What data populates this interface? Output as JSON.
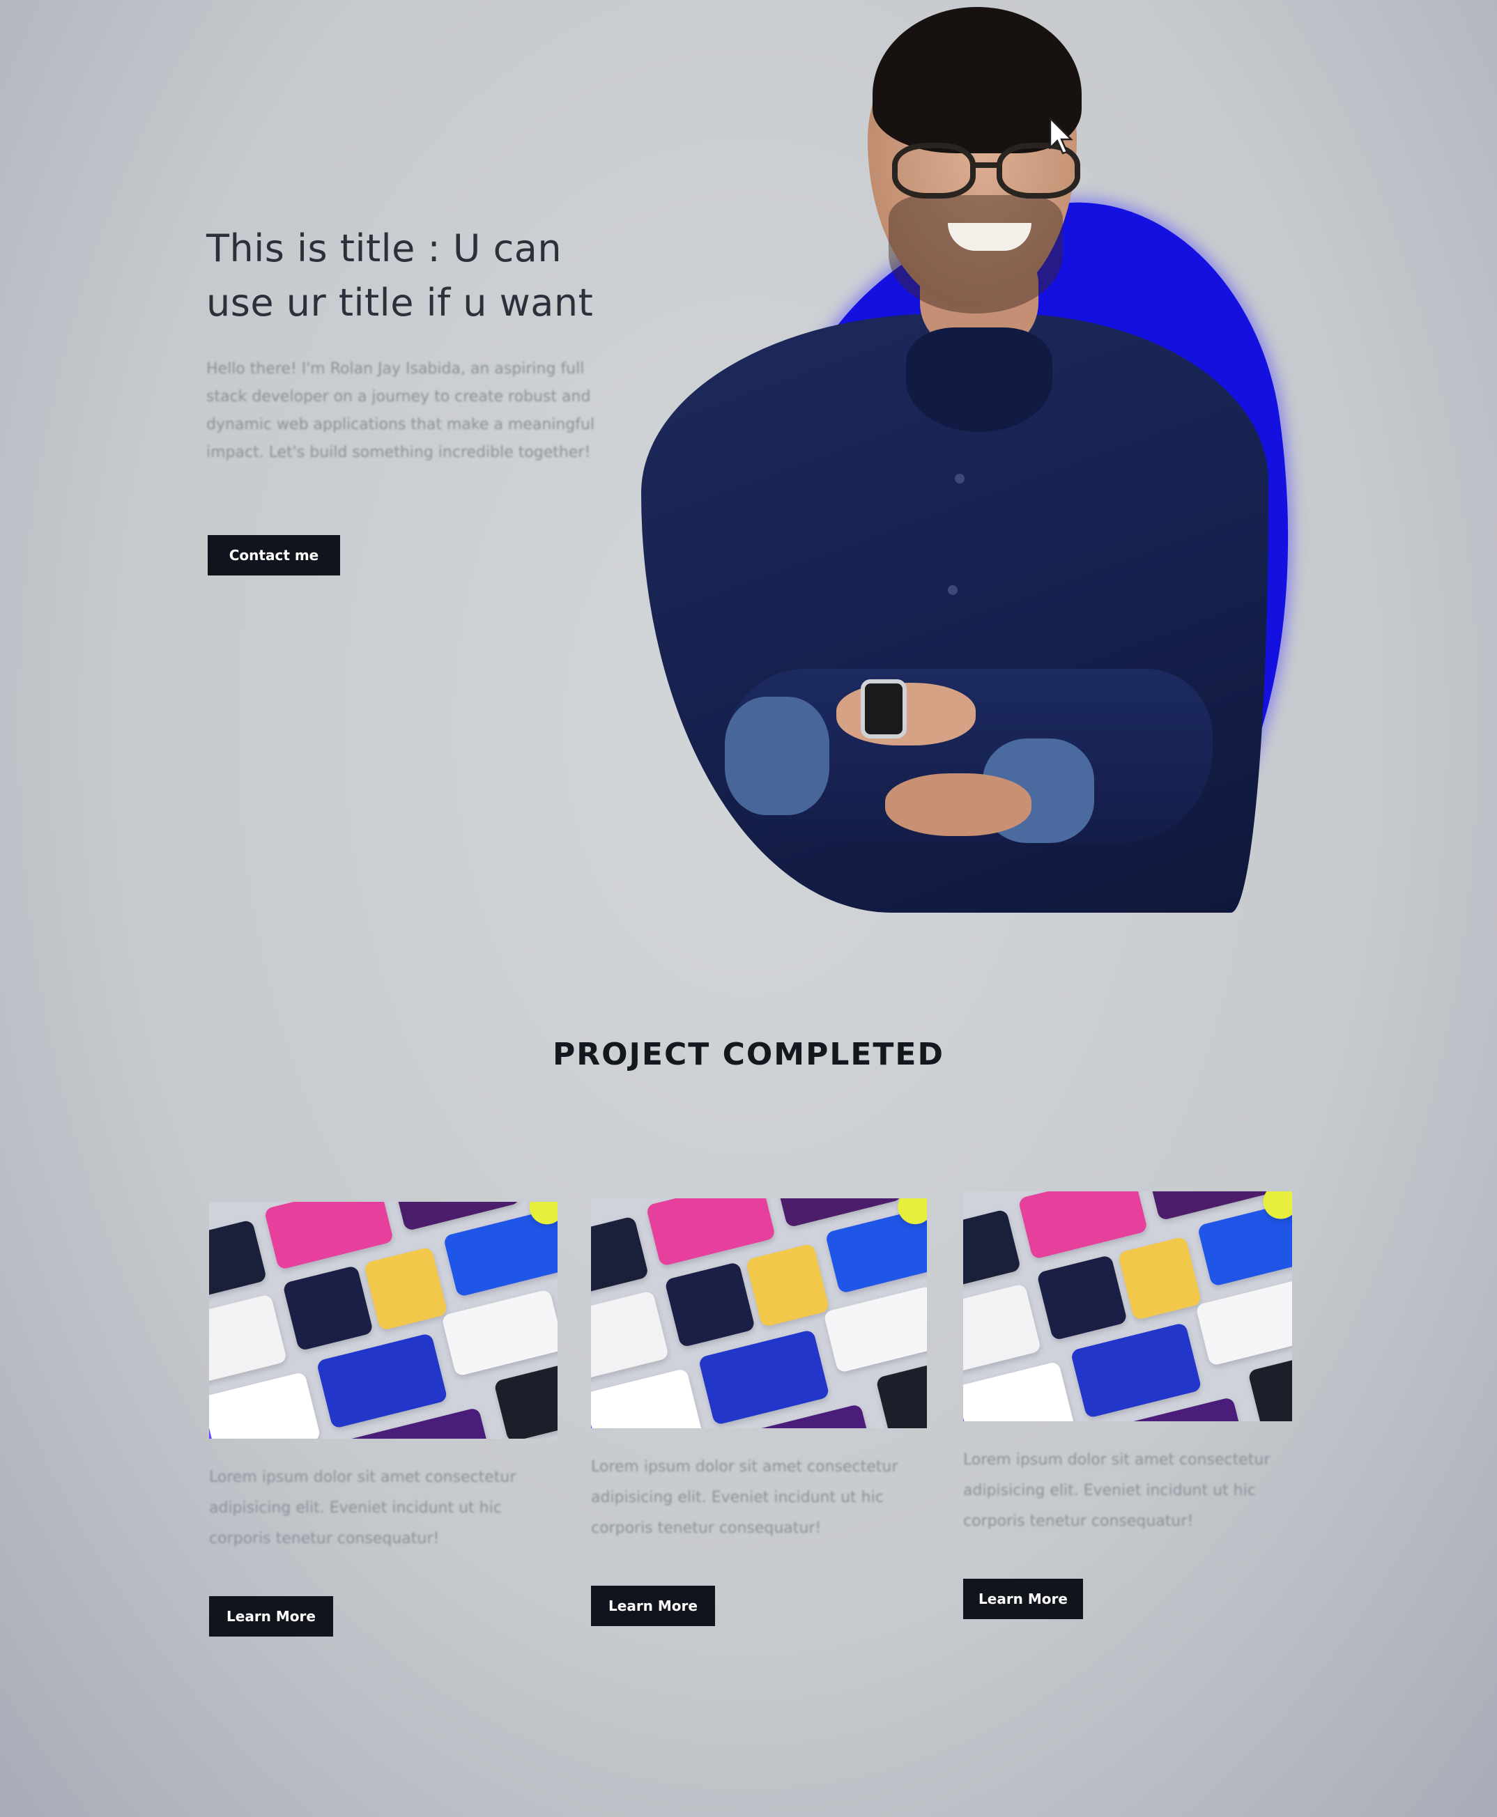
{
  "hero": {
    "title": "This is title : U can use ur title if u want",
    "description": "Hello there! I'm Rolan Jay Isabida, an aspiring full stack developer on a journey to create robust and dynamic web applications that make a meaningful impact. Let's build something incredible together!",
    "contact_label": "Contact me"
  },
  "projects": {
    "heading": "PROJECT COMPLETED",
    "cards": [
      {
        "description": "Lorem ipsum dolor sit amet consectetur adipisicing elit. Eveniet incidunt ut hic corporis tenetur consequatur!",
        "button_label": "Learn More"
      },
      {
        "description": "Lorem ipsum dolor sit amet consectetur adipisicing elit. Eveniet incidunt ut hic corporis tenetur consequatur!",
        "button_label": "Learn More"
      },
      {
        "description": "Lorem ipsum dolor sit amet consectetur adipisicing elit. Eveniet incidunt ut hic corporis tenetur consequatur!",
        "button_label": "Learn More"
      }
    ]
  },
  "colors": {
    "accent_blue": "#1410e0",
    "button_dark": "#11141c",
    "page_background": "#c9ccd0"
  }
}
